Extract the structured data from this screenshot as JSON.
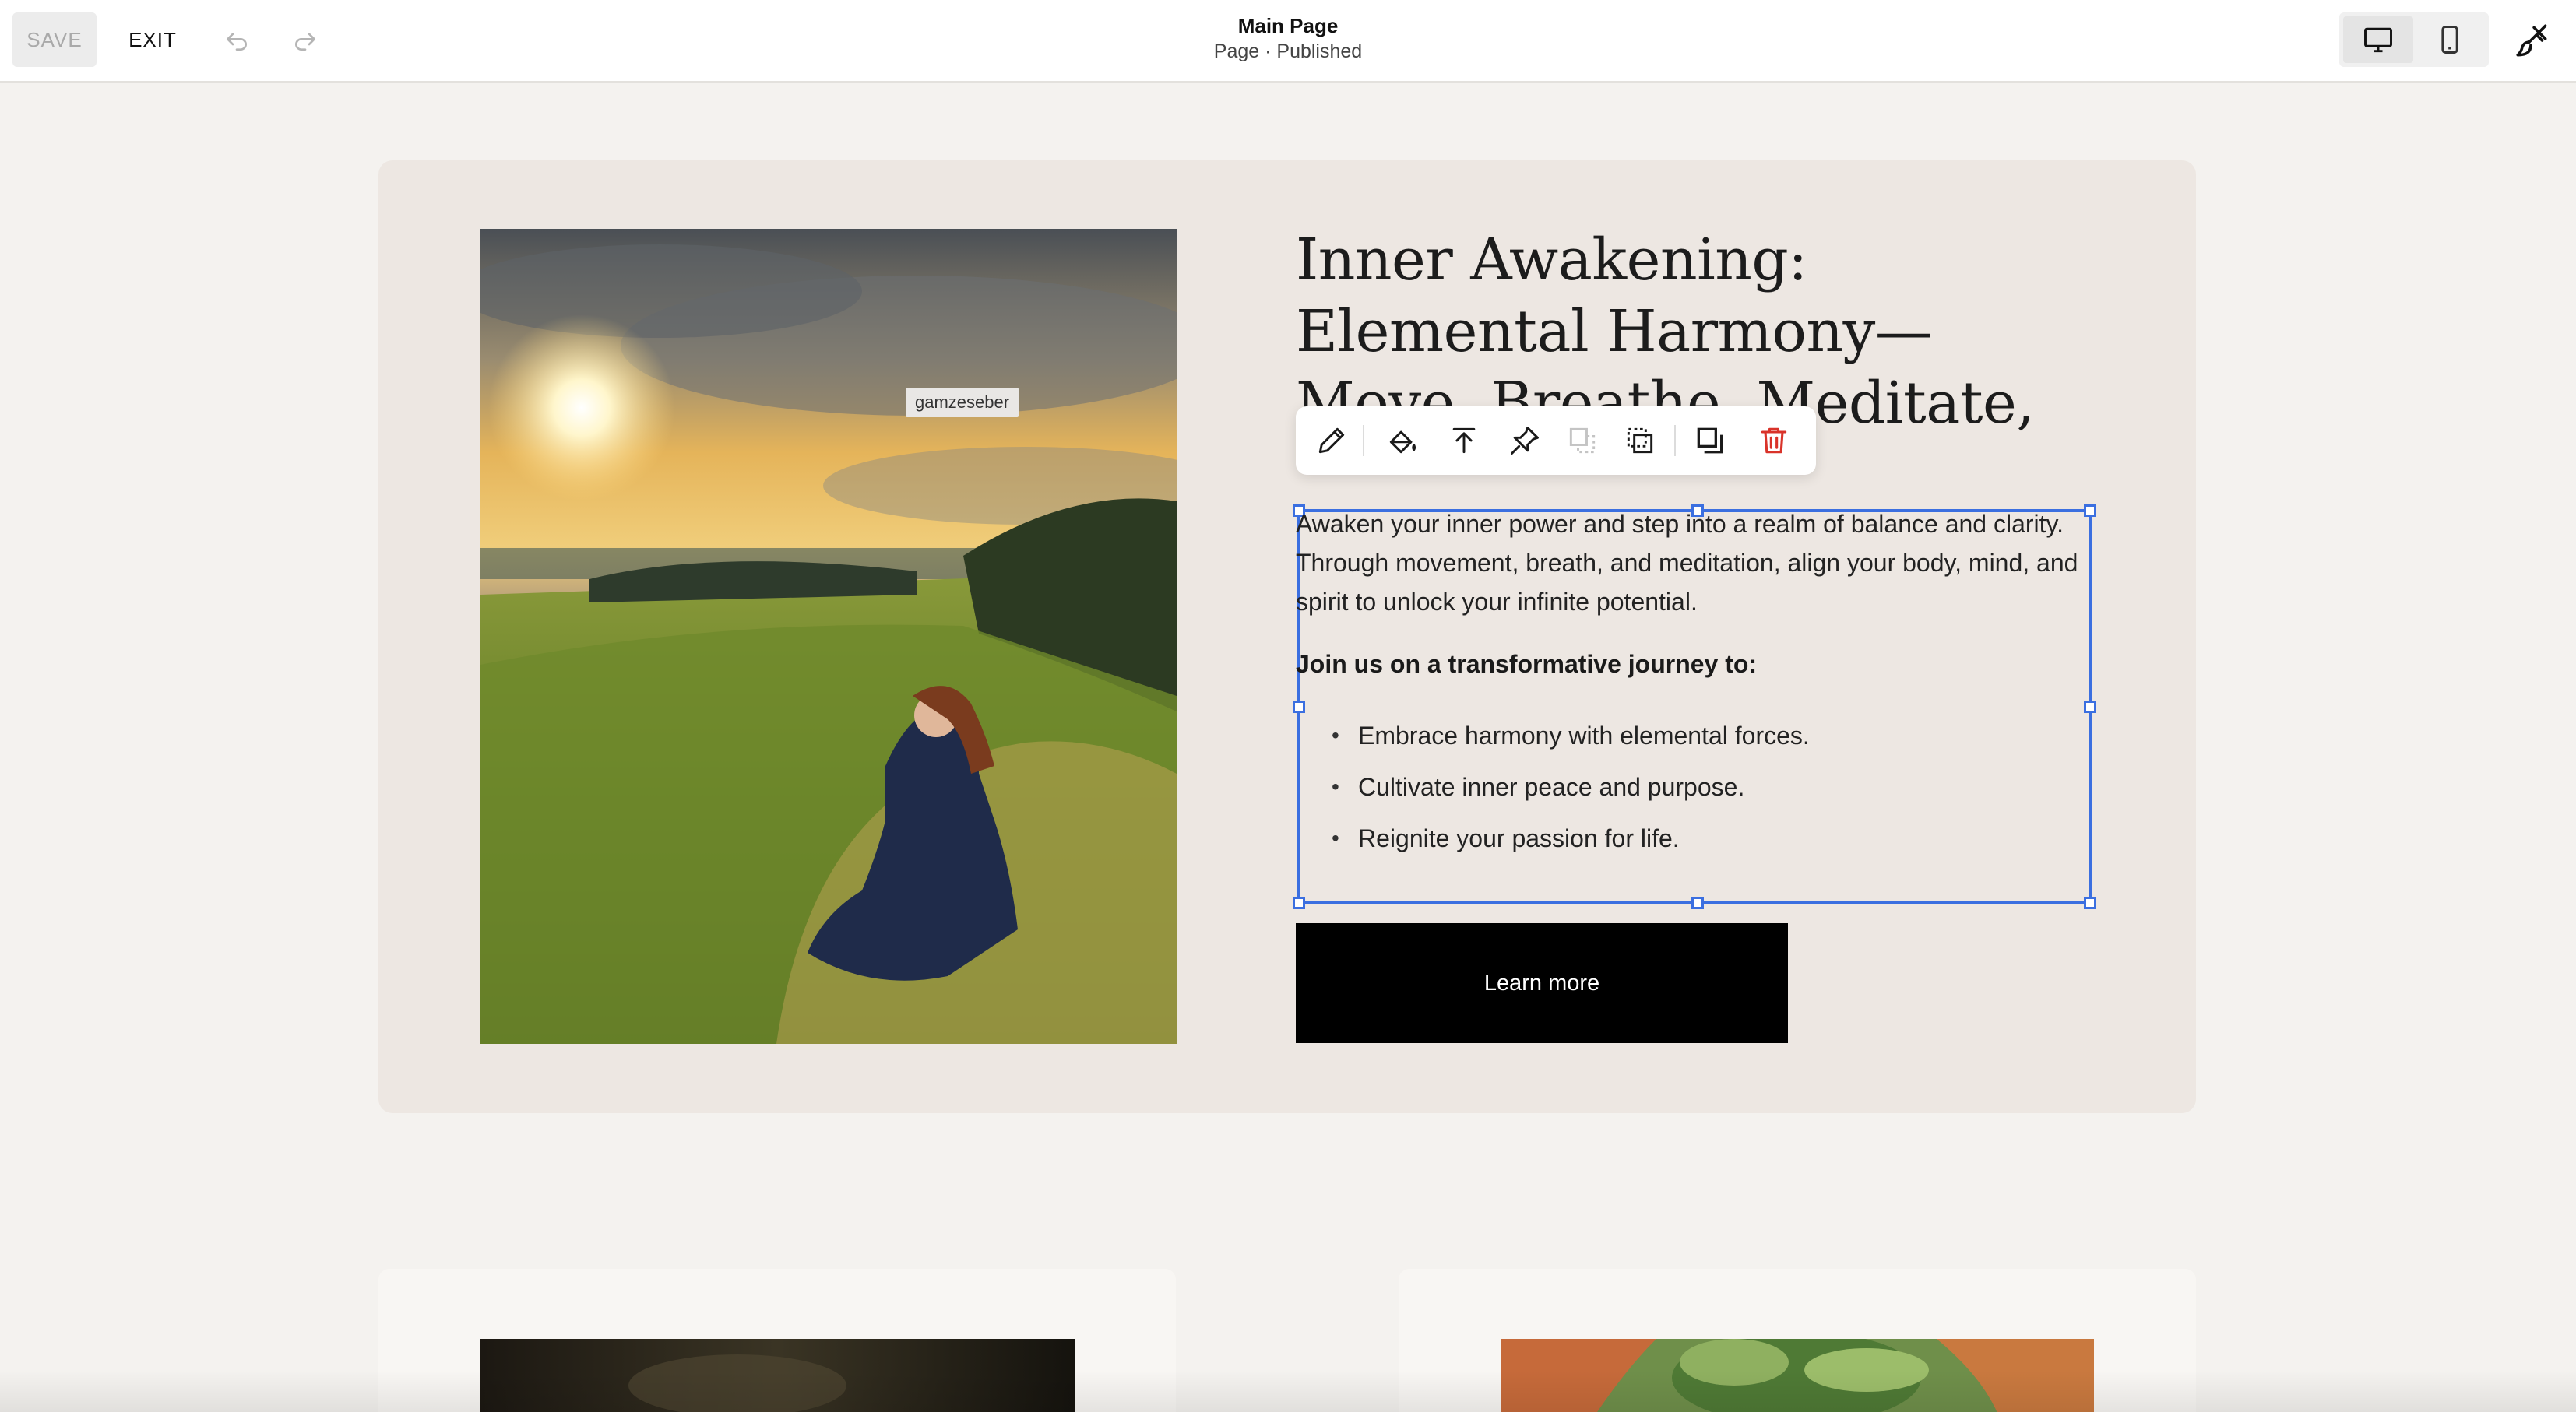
{
  "toolbar": {
    "save_label": "SAVE",
    "exit_label": "EXIT",
    "undo_icon": "undo-icon",
    "redo_icon": "redo-icon"
  },
  "header": {
    "title": "Main Page",
    "status": "Page · Published"
  },
  "device_toggle": {
    "options": [
      "desktop-icon",
      "mobile-icon"
    ],
    "selected": "desktop"
  },
  "design_icon": "paintbrush-icon",
  "section": {
    "photo_credit": "gamzeseber",
    "heading": "Inner Awakening: Elemental Harmony—Move, Breathe, Meditate, and Elevate the Mind",
    "paragraph": "Awaken your inner power and step into a realm of balance and clarity. Through movement, breath, and meditation, align your body, mind, and spirit to unlock your infinite potential.",
    "subheading": "Join us on a transformative journey to:",
    "bullets": [
      "Embrace harmony with elemental forces.",
      "Cultivate inner peace and purpose.",
      "Reignite your passion for life."
    ],
    "button_label": "Learn more"
  },
  "block_toolbar": {
    "icons": [
      "edit-pencil-icon",
      "fill-bucket-icon",
      "move-to-top-icon",
      "pin-icon",
      "duplicate-disabled-icon",
      "select-area-icon",
      "copy-layers-icon",
      "trash-icon"
    ]
  },
  "colors": {
    "selection": "#3b6fe0",
    "card_bg": "#ede7e2",
    "page_bg": "#f4f2ef",
    "button_bg": "#000000",
    "trash": "#d9332a"
  }
}
